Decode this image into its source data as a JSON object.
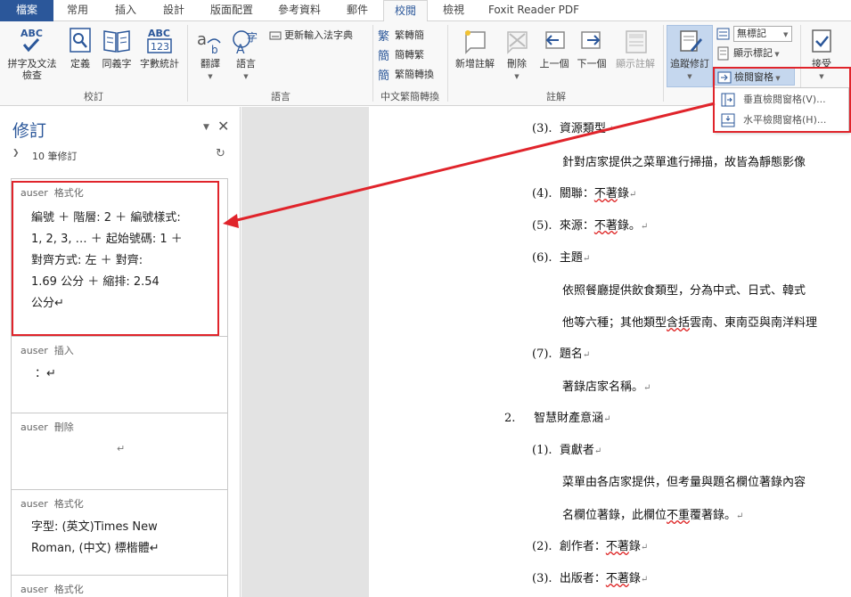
{
  "tabs": [
    "檔案",
    "常用",
    "插入",
    "設計",
    "版面配置",
    "參考資料",
    "郵件",
    "校閱",
    "檢視",
    "Foxit Reader PDF"
  ],
  "ribbon": {
    "proofing": {
      "spell": "拼字及文法檢查",
      "spell_l1": "拼字及文法",
      "spell_l2": "檢查",
      "define": "定義",
      "thesaurus": "同義字",
      "wordcount": "字數統計",
      "group": "校訂",
      "abc": "ABC",
      "num": "123"
    },
    "language": {
      "translate": "翻譯",
      "language": "語言",
      "update_ime": "更新輸入法字典",
      "group": "語言"
    },
    "chinese": {
      "to_trad": "繁轉簡",
      "to_simp": "簡轉繁",
      "convert": "繁簡轉換",
      "group": "中文繁簡轉換",
      "g1": "繁",
      "g2": "簡",
      "g3": "簡"
    },
    "comments": {
      "new": "新增註解",
      "delete": "刪除",
      "prev": "上一個",
      "next": "下一個",
      "show": "顯示註解",
      "group": "註解"
    },
    "tracking": {
      "track": "追蹤修訂",
      "markup_select": "無標記",
      "show_markup": "顯示標記",
      "pane": "檢閱窗格",
      "accept": "接受"
    }
  },
  "dropdown": {
    "vertical": "垂直檢閱窗格(V)...",
    "horizontal": "水平檢閱窗格(H)..."
  },
  "pane": {
    "title": "修訂",
    "summary": "10 筆修訂",
    "revisions": [
      {
        "author": "auser",
        "type": "格式化",
        "lines": [
          "編號 ＋ 階層: 2 ＋ 編號樣式:",
          "1, 2, 3, … ＋ 起始號碼: 1 ＋",
          "對齊方式: 左 ＋ 對齊:",
          "1.69 公分 ＋ 縮排:  2.54",
          "公分↵"
        ]
      },
      {
        "author": "auser",
        "type": "插入",
        "lines": [
          "：↵"
        ]
      },
      {
        "author": "auser",
        "type": "刪除",
        "lines": [
          "↵"
        ]
      },
      {
        "author": "auser",
        "type": "格式化",
        "lines": [
          "字型: (英文)Times New",
          "Roman, (中文) 標楷體↵"
        ]
      },
      {
        "author": "auser",
        "type": "格式化",
        "lines": []
      }
    ]
  },
  "doc": {
    "l1": "(3).",
    "l1t": "資源類型",
    "l2": "針對店家提供之菜單進行掃描，故皆為靜態影像",
    "l3": "(4).",
    "l3t": "關聯：",
    "l3s": "不著",
    "l3e": "錄",
    "l4": "(5).",
    "l4t": "來源：",
    "l4s": "不著",
    "l4e": "錄。",
    "l5": "(6).",
    "l5t": "主題",
    "l6": "依照餐廳提供飲食類型，分為中式、日式、韓式",
    "l7a": "他等六種；其他類型",
    "l7s": "含括",
    "l7e": "雲南、東南亞與南洋料理",
    "l8": "(7).",
    "l8t": "題名",
    "l9": "著錄店家名稱。",
    "l10": "2.",
    "l10t": "智慧財產意涵",
    "l11": "(1).",
    "l11t": "貢獻者",
    "l12": "菜單由各店家提供，但考量與題名欄位著錄內容",
    "l13a": "名欄位著錄，此欄位",
    "l13s": "不重",
    "l13e": "覆著錄。",
    "l14": "(2).",
    "l14t": "創作者：",
    "l14s": "不著",
    "l14e": "錄",
    "l15": "(3).",
    "l15t": "出版者：",
    "l15s": "不著",
    "l15e": "錄",
    "pilcrow": "↵"
  },
  "colors": {
    "accent": "#2b579a",
    "annotation": "#e0242b"
  }
}
